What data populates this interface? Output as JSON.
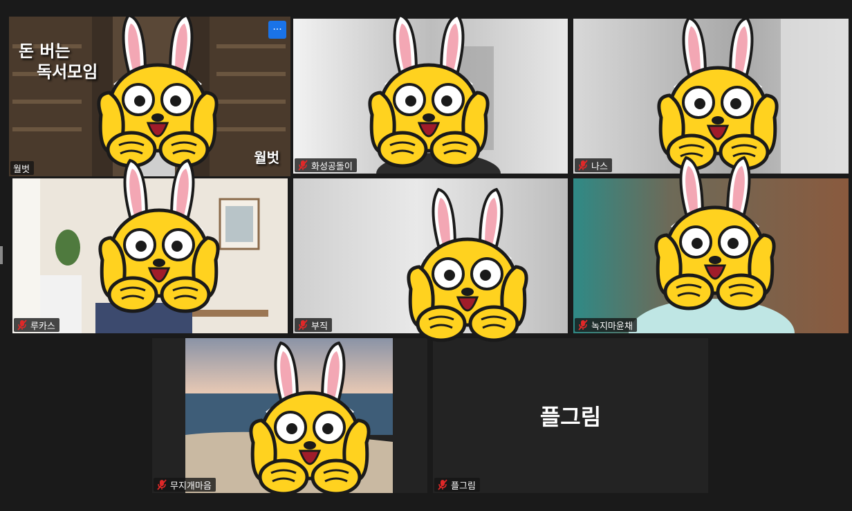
{
  "window": {
    "title": ""
  },
  "tiles": [
    {
      "name": "월벗",
      "muted": false,
      "active": true,
      "banner": {
        "line1": "돈 버는",
        "line2": "독서모임",
        "corner": "월벗"
      },
      "more_label": "···"
    },
    {
      "name": "화성공돌이",
      "muted": true
    },
    {
      "name": "나스",
      "muted": true
    },
    {
      "name": "루카스",
      "muted": true
    },
    {
      "name": "부직",
      "muted": true
    },
    {
      "name": "녹지마윤채",
      "muted": true
    },
    {
      "name": "무지개마음",
      "muted": true
    },
    {
      "name": "플그림",
      "muted": true,
      "avatar_text": "플그림"
    }
  ],
  "sticker": {
    "icon": "yellow-rabbit-ears-character-icon"
  },
  "colors": {
    "active_border": "#e8f06a",
    "mute_icon": "#e02828",
    "more_button": "#1a73e8",
    "sticker_yellow": "#ffd21f"
  }
}
